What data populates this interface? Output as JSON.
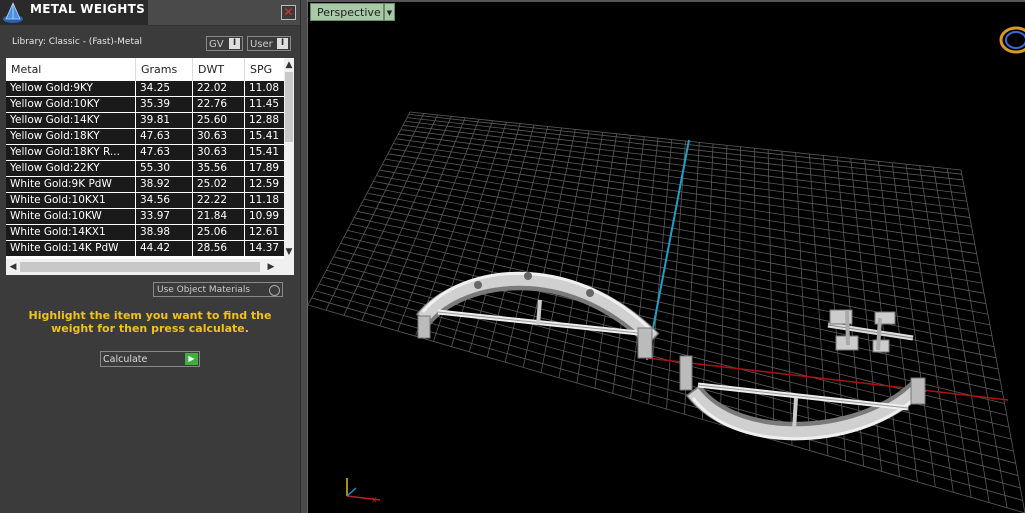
{
  "panel": {
    "title": "METAL WEIGHTS",
    "close_label": "✕",
    "library_label": "Library: Classic - (Fast)-Metal",
    "gv_label": "GV",
    "user_label": "User",
    "toggle_knob": "I",
    "use_object_materials": "Use Object Materials",
    "hint": "Highlight the item you want to find the weight for then press calculate.",
    "calculate_label": "Calculate",
    "calculate_go": "▶"
  },
  "table": {
    "headers": [
      "Metal",
      "Grams",
      "DWT",
      "SPG"
    ],
    "rows": [
      [
        "Yellow Gold:9KY",
        "34.25",
        "22.02",
        "11.08"
      ],
      [
        "Yellow Gold:10KY",
        "35.39",
        "22.76",
        "11.45"
      ],
      [
        "Yellow Gold:14KY",
        "39.81",
        "25.60",
        "12.88"
      ],
      [
        "Yellow Gold:18KY",
        "47.63",
        "30.63",
        "15.41"
      ],
      [
        "Yellow Gold:18KY R...",
        "47.63",
        "30.63",
        "15.41"
      ],
      [
        "Yellow Gold:22KY",
        "55.30",
        "35.56",
        "17.89"
      ],
      [
        "White Gold:9K PdW",
        "38.92",
        "25.02",
        "12.59"
      ],
      [
        "White Gold:10KX1",
        "34.56",
        "22.22",
        "11.18"
      ],
      [
        "White Gold:10KW",
        "33.97",
        "21.84",
        "10.99"
      ],
      [
        "White Gold:14KX1",
        "38.98",
        "25.06",
        "12.61"
      ],
      [
        "White Gold:14K PdW",
        "44.42",
        "28.56",
        "14.37"
      ]
    ]
  },
  "viewport": {
    "view_label": "Perspective",
    "colors": {
      "grid": "#5a5a5a",
      "y_axis": "#1f9fc8",
      "x_axis": "#b01010",
      "model": "#d8d8d8",
      "tab": "#a8c9a6"
    }
  }
}
